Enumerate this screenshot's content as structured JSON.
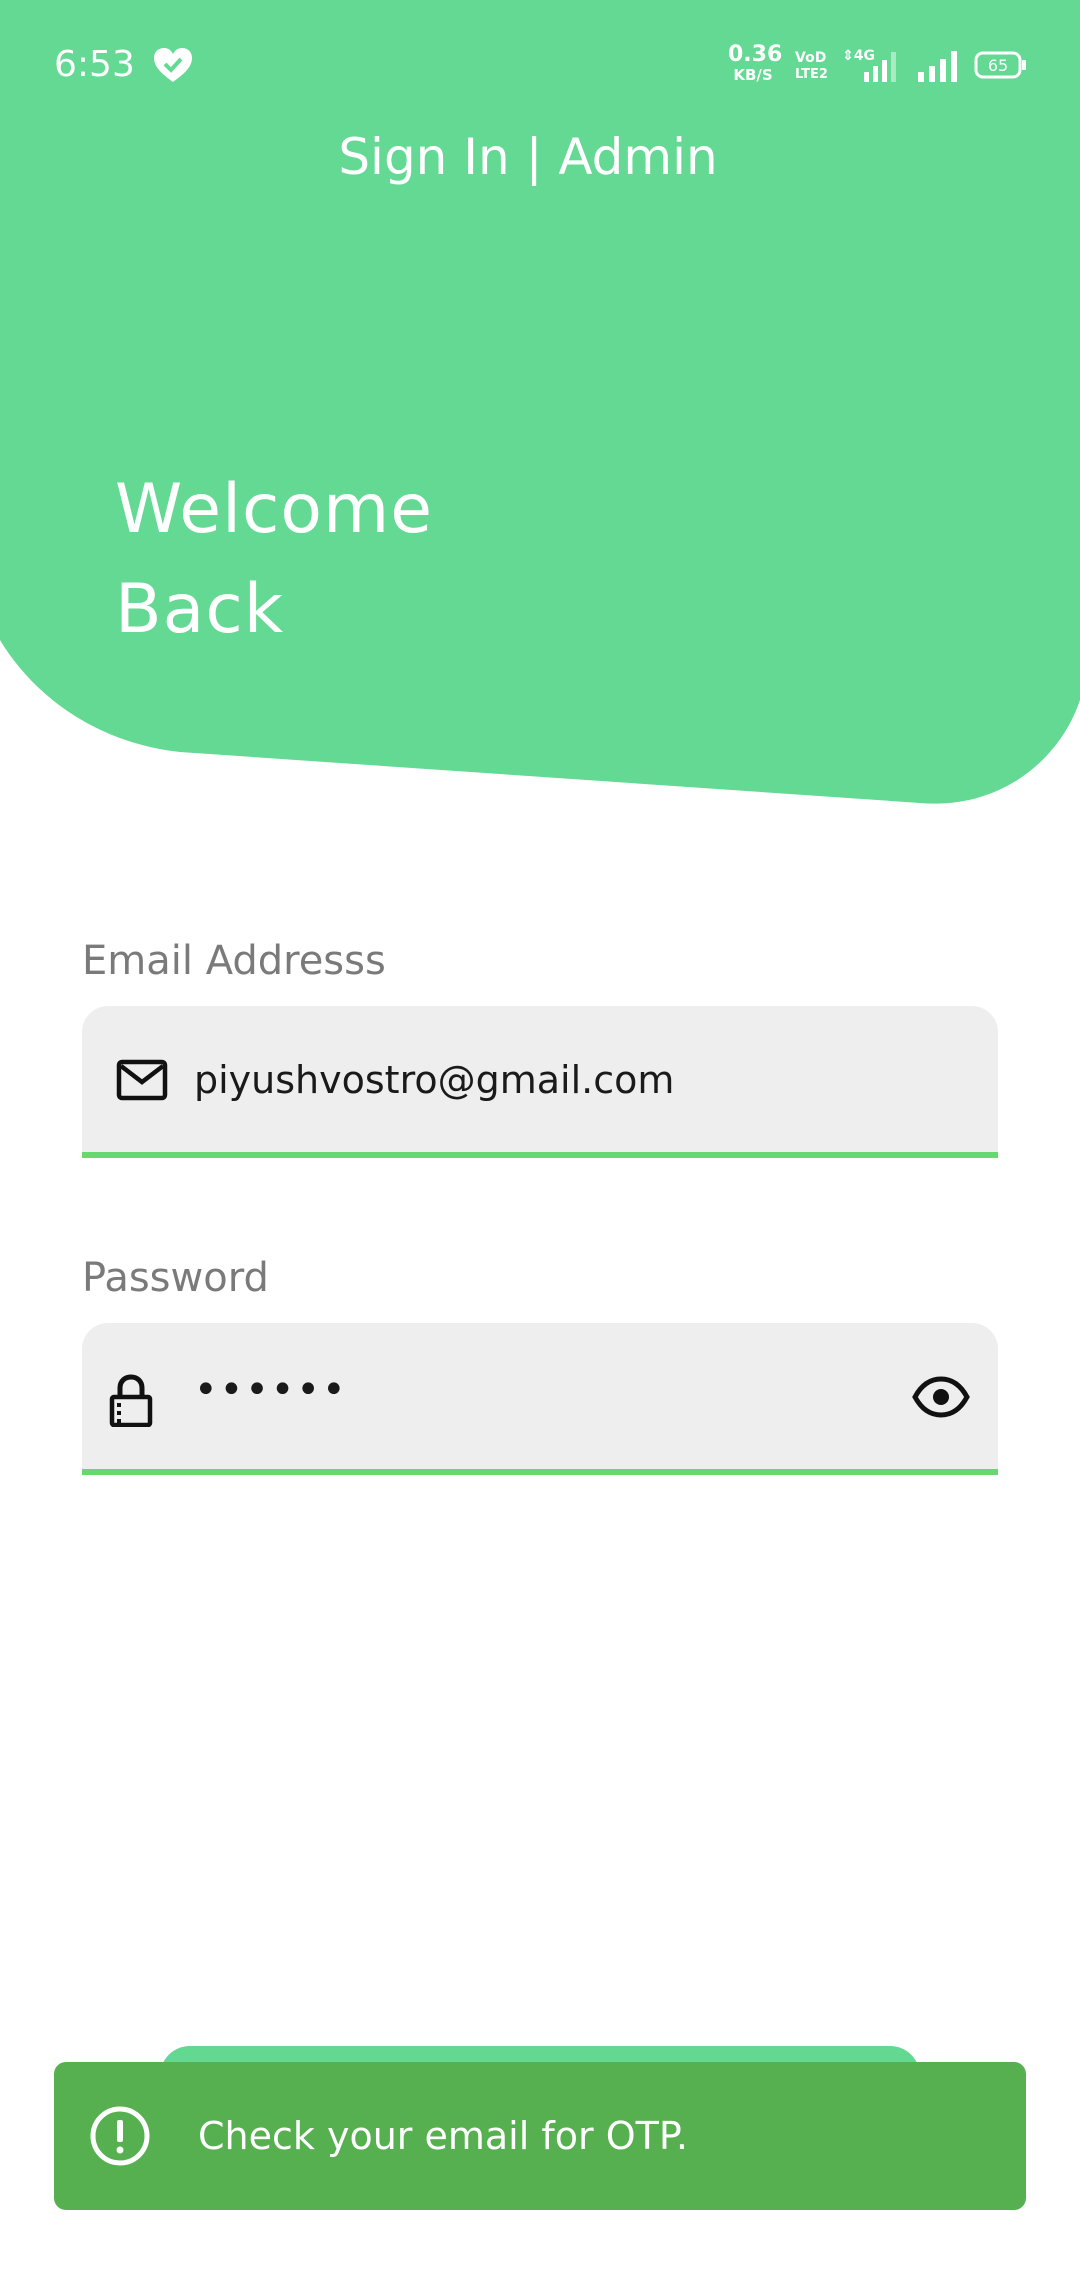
{
  "status_bar": {
    "time": "6:53",
    "net_speed_value": "0.36",
    "net_speed_unit": "KB/S",
    "battery_level": "65"
  },
  "header": {
    "title": "Sign In | Admin",
    "welcome_line1": "Welcome",
    "welcome_line2": "Back"
  },
  "form": {
    "email": {
      "label": "Email Addresss",
      "value": "piyushvostro@gmail.com"
    },
    "password": {
      "label": "Password",
      "value": "••••••"
    }
  },
  "snackbar": {
    "message": "Check your email for OTP."
  },
  "colors": {
    "header_green": "#63d993",
    "field_underline": "#66d86f",
    "snackbar_green": "#56b050",
    "field_background": "#eeeeee"
  },
  "icons": {
    "status": "heart-check-icon",
    "email": "mail-icon",
    "password": "lock-icon",
    "visibility": "eye-icon",
    "snackbar": "alert-circle-icon"
  }
}
